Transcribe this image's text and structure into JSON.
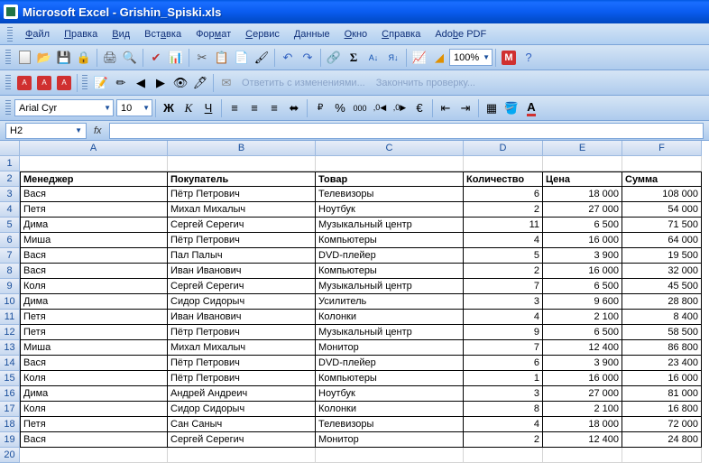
{
  "app": {
    "name": "Microsoft Excel",
    "document": "Grishin_Spiski.xls"
  },
  "menu": [
    "Файл",
    "Правка",
    "Вид",
    "Вставка",
    "Формат",
    "Сервис",
    "Данные",
    "Окно",
    "Справка",
    "Adobe PDF"
  ],
  "font": {
    "name": "Arial Cyr",
    "size": "10"
  },
  "zoom": "100%",
  "review_text1": "Ответить с изменениями...",
  "review_text2": "Закончить проверку...",
  "namebox": "H2",
  "fx": "fx",
  "columns": [
    "A",
    "B",
    "C",
    "D",
    "E",
    "F"
  ],
  "headers": {
    "A": "Менеджер",
    "B": "Покупатель",
    "C": "Товар",
    "D": "Количество",
    "E": "Цена",
    "F": "Сумма"
  },
  "rows": [
    {
      "A": "Вася",
      "B": "Пётр Петрович",
      "C": "Телевизоры",
      "D": "6",
      "E": "18 000",
      "F": "108 000"
    },
    {
      "A": "Петя",
      "B": "Михал Михалыч",
      "C": "Ноутбук",
      "D": "2",
      "E": "27 000",
      "F": "54 000"
    },
    {
      "A": "Дима",
      "B": "Сергей Серегич",
      "C": "Музыкальный центр",
      "D": "11",
      "E": "6 500",
      "F": "71 500"
    },
    {
      "A": "Миша",
      "B": "Пётр Петрович",
      "C": "Компьютеры",
      "D": "4",
      "E": "16 000",
      "F": "64 000"
    },
    {
      "A": "Вася",
      "B": "Пал Палыч",
      "C": "DVD-плейер",
      "D": "5",
      "E": "3 900",
      "F": "19 500"
    },
    {
      "A": "Вася",
      "B": "Иван Иванович",
      "C": "Компьютеры",
      "D": "2",
      "E": "16 000",
      "F": "32 000"
    },
    {
      "A": "Коля",
      "B": "Сергей Серегич",
      "C": "Музыкальный центр",
      "D": "7",
      "E": "6 500",
      "F": "45 500"
    },
    {
      "A": "Дима",
      "B": "Сидор Сидорыч",
      "C": "Усилитель",
      "D": "3",
      "E": "9 600",
      "F": "28 800"
    },
    {
      "A": "Петя",
      "B": "Иван Иванович",
      "C": "Колонки",
      "D": "4",
      "E": "2 100",
      "F": "8 400"
    },
    {
      "A": "Петя",
      "B": "Пётр Петрович",
      "C": "Музыкальный центр",
      "D": "9",
      "E": "6 500",
      "F": "58 500"
    },
    {
      "A": "Миша",
      "B": "Михал Михалыч",
      "C": "Монитор",
      "D": "7",
      "E": "12 400",
      "F": "86 800"
    },
    {
      "A": "Вася",
      "B": "Пётр Петрович",
      "C": "DVD-плейер",
      "D": "6",
      "E": "3 900",
      "F": "23 400"
    },
    {
      "A": "Коля",
      "B": "Пётр Петрович",
      "C": "Компьютеры",
      "D": "1",
      "E": "16 000",
      "F": "16 000"
    },
    {
      "A": "Дима",
      "B": "Андрей Андреич",
      "C": "Ноутбук",
      "D": "3",
      "E": "27 000",
      "F": "81 000"
    },
    {
      "A": "Коля",
      "B": "Сидор Сидорыч",
      "C": "Колонки",
      "D": "8",
      "E": "2 100",
      "F": "16 800"
    },
    {
      "A": "Петя",
      "B": "Сан Саныч",
      "C": "Телевизоры",
      "D": "4",
      "E": "18 000",
      "F": "72 000"
    },
    {
      "A": "Вася",
      "B": "Сергей Серегич",
      "C": "Монитор",
      "D": "2",
      "E": "12 400",
      "F": "24 800"
    }
  ]
}
